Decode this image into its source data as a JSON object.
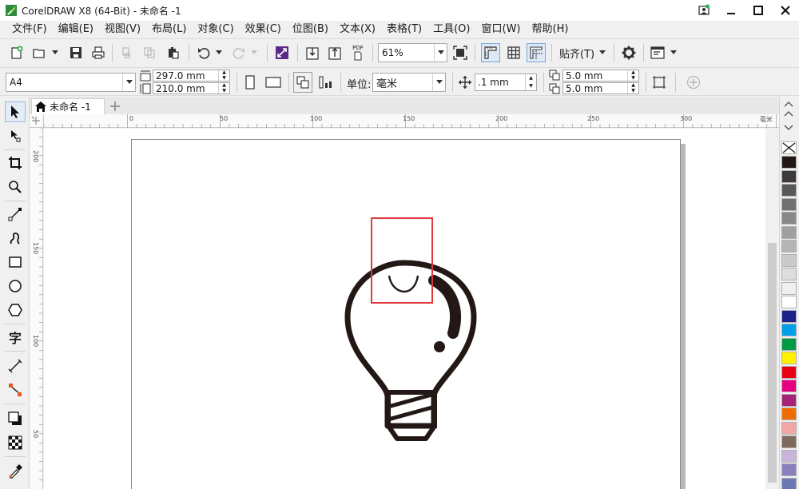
{
  "window": {
    "title": "CorelDRAW X8 (64-Bit) - 未命名 -1",
    "controls": [
      "status-icon",
      "minimize-icon",
      "maximize-icon",
      "close-icon"
    ]
  },
  "menu": [
    "文件(F)",
    "编辑(E)",
    "视图(V)",
    "布局(L)",
    "对象(C)",
    "效果(C)",
    "位图(B)",
    "文本(X)",
    "表格(T)",
    "工具(O)",
    "窗口(W)",
    "帮助(H)"
  ],
  "toolbar": {
    "zoom_value": "61%",
    "snap_label": "贴齐(T)",
    "pdf_label": "PDF"
  },
  "property_bar": {
    "page_size": "A4",
    "page_width": "297.0 mm",
    "page_height": "210.0 mm",
    "unit_label": "单位:",
    "unit_value": "毫米",
    "nudge": ".1 mm",
    "dup_x": "5.0 mm",
    "dup_y": "5.0 mm"
  },
  "document": {
    "tab_label": "未命名 -1"
  },
  "ruler": {
    "h_labels": [
      "0",
      "50",
      "100",
      "150",
      "200",
      "250",
      "300"
    ],
    "h_unit": "毫米",
    "v_labels": [
      "200",
      "150",
      "100",
      "50"
    ]
  },
  "palette": [
    "#231815",
    "#3e3a39",
    "#595757",
    "#727171",
    "#898989",
    "#9fa0a0",
    "#b5b5b6",
    "#c9caca",
    "#dcdddd",
    "#efefef",
    "#ffffff",
    "#1d2088",
    "#00a0e9",
    "#009944",
    "#fff100",
    "#e60012",
    "#e4007f",
    "#a6227a",
    "#ed6d00",
    "#f1a7a7",
    "#7d6a5c",
    "#c7b6d8",
    "#8a7fbf",
    "#6d77b6"
  ]
}
